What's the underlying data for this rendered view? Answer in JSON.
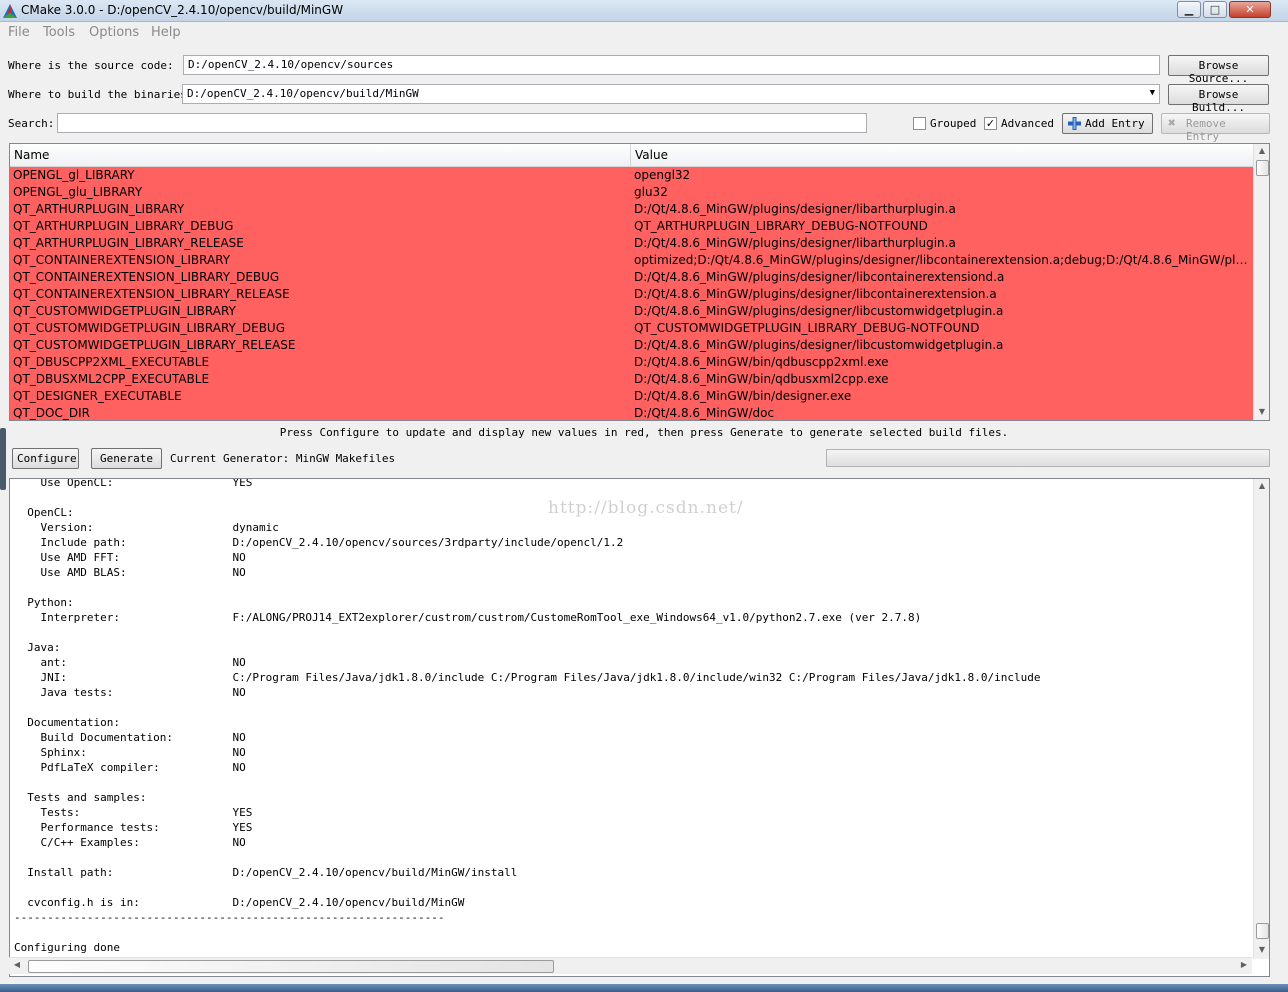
{
  "window": {
    "title": "CMake 3.0.0 - D:/openCV_2.4.10/opencv/build/MinGW",
    "min_label": "▁",
    "max_label": "□",
    "close_label": "✕"
  },
  "menu": {
    "file": "File",
    "tools": "Tools",
    "options": "Options",
    "help": "Help"
  },
  "source": {
    "label": "Where is the source code:",
    "value": "D:/openCV_2.4.10/opencv/sources",
    "browse_label": "Browse Source..."
  },
  "build": {
    "label": "Where to build the binaries:",
    "value": "D:/openCV_2.4.10/opencv/build/MinGW",
    "browse_label": "Browse Build..."
  },
  "search": {
    "label": "Search:",
    "value": ""
  },
  "options": {
    "grouped_label": "Grouped",
    "grouped_checked": false,
    "advanced_label": "Advanced",
    "advanced_checked": true,
    "add_entry_label": "Add Entry",
    "remove_entry_label": "Remove Entry"
  },
  "table": {
    "col_name": "Name",
    "col_value": "Value",
    "row_color": "#ff6161",
    "rows": [
      {
        "name": "OPENGL_gl_LIBRARY",
        "value": "opengl32"
      },
      {
        "name": "OPENGL_glu_LIBRARY",
        "value": "glu32"
      },
      {
        "name": "QT_ARTHURPLUGIN_LIBRARY",
        "value": "D:/Qt/4.8.6_MinGW/plugins/designer/libarthurplugin.a"
      },
      {
        "name": "QT_ARTHURPLUGIN_LIBRARY_DEBUG",
        "value": "QT_ARTHURPLUGIN_LIBRARY_DEBUG-NOTFOUND"
      },
      {
        "name": "QT_ARTHURPLUGIN_LIBRARY_RELEASE",
        "value": "D:/Qt/4.8.6_MinGW/plugins/designer/libarthurplugin.a"
      },
      {
        "name": "QT_CONTAINEREXTENSION_LIBRARY",
        "value": "optimized;D:/Qt/4.8.6_MinGW/plugins/designer/libcontainerextension.a;debug;D:/Qt/4.8.6_MinGW/plugi..."
      },
      {
        "name": "QT_CONTAINEREXTENSION_LIBRARY_DEBUG",
        "value": "D:/Qt/4.8.6_MinGW/plugins/designer/libcontainerextensiond.a"
      },
      {
        "name": "QT_CONTAINEREXTENSION_LIBRARY_RELEASE",
        "value": "D:/Qt/4.8.6_MinGW/plugins/designer/libcontainerextension.a"
      },
      {
        "name": "QT_CUSTOMWIDGETPLUGIN_LIBRARY",
        "value": "D:/Qt/4.8.6_MinGW/plugins/designer/libcustomwidgetplugin.a"
      },
      {
        "name": "QT_CUSTOMWIDGETPLUGIN_LIBRARY_DEBUG",
        "value": "QT_CUSTOMWIDGETPLUGIN_LIBRARY_DEBUG-NOTFOUND"
      },
      {
        "name": "QT_CUSTOMWIDGETPLUGIN_LIBRARY_RELEASE",
        "value": "D:/Qt/4.8.6_MinGW/plugins/designer/libcustomwidgetplugin.a"
      },
      {
        "name": "QT_DBUSCPP2XML_EXECUTABLE",
        "value": "D:/Qt/4.8.6_MinGW/bin/qdbuscpp2xml.exe"
      },
      {
        "name": "QT_DBUSXML2CPP_EXECUTABLE",
        "value": "D:/Qt/4.8.6_MinGW/bin/qdbusxml2cpp.exe"
      },
      {
        "name": "QT_DESIGNER_EXECUTABLE",
        "value": "D:/Qt/4.8.6_MinGW/bin/designer.exe"
      },
      {
        "name": "QT_DOC_DIR",
        "value": "D:/Qt/4.8.6_MinGW/doc"
      }
    ]
  },
  "hint": "Press Configure to update and display new values in red, then press Generate to generate selected build files.",
  "actions": {
    "configure_label": "Configure",
    "generate_label": "Generate",
    "generator_text": "Current Generator: MinGW Makefiles"
  },
  "watermark": "http://blog.csdn.net/",
  "output_lines": [
    "    Use OpenCL:                  YES",
    "",
    "  OpenCL:",
    "    Version:                     dynamic",
    "    Include path:                D:/openCV_2.4.10/opencv/sources/3rdparty/include/opencl/1.2",
    "    Use AMD FFT:                 NO",
    "    Use AMD BLAS:                NO",
    "",
    "  Python:",
    "    Interpreter:                 F:/ALONG/PROJ14_EXT2explorer/custrom/custrom/CustomeRomTool_exe_Windows64_v1.0/python2.7.exe (ver 2.7.8)",
    "",
    "  Java:",
    "    ant:                         NO",
    "    JNI:                         C:/Program Files/Java/jdk1.8.0/include C:/Program Files/Java/jdk1.8.0/include/win32 C:/Program Files/Java/jdk1.8.0/include",
    "    Java tests:                  NO",
    "",
    "  Documentation:",
    "    Build Documentation:         NO",
    "    Sphinx:                      NO",
    "    PdfLaTeX compiler:           NO",
    "",
    "  Tests and samples:",
    "    Tests:                       YES",
    "    Performance tests:           YES",
    "    C/C++ Examples:              NO",
    "",
    "  Install path:                  D:/openCV_2.4.10/opencv/build/MinGW/install",
    "",
    "  cvconfig.h is in:              D:/openCV_2.4.10/opencv/build/MinGW",
    "-----------------------------------------------------------------",
    "",
    "Configuring done"
  ]
}
